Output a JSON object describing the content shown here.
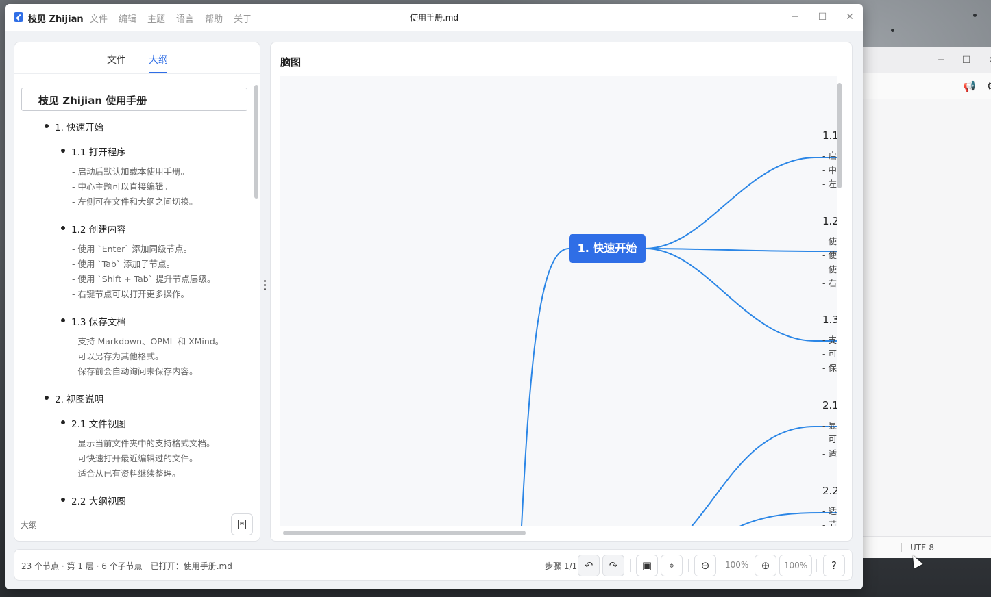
{
  "app": {
    "name": "枝见 Zhijian",
    "menu": [
      "文件",
      "编辑",
      "主题",
      "语言",
      "帮助",
      "关于"
    ],
    "window_title": "使用手册.md",
    "accent_color": "#2f6ee6"
  },
  "left_panel": {
    "tabs": [
      {
        "label": "文件",
        "active": false
      },
      {
        "label": "大纲",
        "active": true
      }
    ],
    "outline": {
      "root": "枝见 Zhijian 使用手册",
      "sections": [
        {
          "title": "1. 快速开始",
          "children": [
            {
              "title": "1.1 打开程序",
              "notes": [
                "- 启动后默认加载本使用手册。",
                "- 中心主题可以直接编辑。",
                "- 左侧可在文件和大纲之间切换。"
              ]
            },
            {
              "title": "1.2 创建内容",
              "notes": [
                "- 使用 `Enter` 添加同级节点。",
                "- 使用 `Tab` 添加子节点。",
                "- 使用 `Shift + Tab` 提升节点层级。",
                "- 右键节点可以打开更多操作。"
              ]
            },
            {
              "title": "1.3 保存文档",
              "notes": [
                "- 支持 Markdown、OPML 和 XMind。",
                "- 可以另存为其他格式。",
                "- 保存前会自动询问未保存内容。"
              ]
            }
          ]
        },
        {
          "title": "2. 视图说明",
          "children": [
            {
              "title": "2.1 文件视图",
              "notes": [
                "- 显示当前文件夹中的支持格式文档。",
                "- 可快速打开最近编辑过的文件。",
                "- 适合从已有资料继续整理。"
              ]
            },
            {
              "title": "2.2 大纲视图",
              "notes": []
            }
          ]
        }
      ]
    },
    "footer_label": "大纲",
    "footer_icon": "markdown-file-icon"
  },
  "map_panel": {
    "title": "脑图",
    "center_node": "1. 快速开始",
    "branches": [
      {
        "title": "1.1",
        "notes": [
          "- 启",
          "- 中",
          "- 左"
        ]
      },
      {
        "title": "1.2",
        "notes": [
          "- 使",
          "- 使",
          "- 使",
          "- 右"
        ]
      },
      {
        "title": "1.3",
        "notes": [
          "- 支",
          "- 可",
          "- 保"
        ]
      },
      {
        "title": "2.1",
        "notes": [
          "- 显",
          "- 可",
          "- 适"
        ]
      },
      {
        "title": "2.2",
        "notes": [
          "- 适",
          "- 节"
        ]
      }
    ]
  },
  "status": {
    "summary": "23 个节点 · 第 1 层 · 6 个子节点",
    "opened": "已打开：使用手册.md",
    "step": "步骤 1/1",
    "zoom_text": "100%",
    "zoom_box": "100%"
  },
  "background_window": {
    "encoding": "UTF-8"
  }
}
